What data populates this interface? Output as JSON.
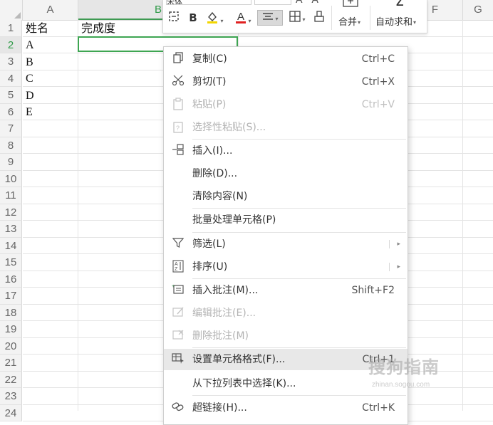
{
  "columns": [
    "A",
    "B",
    "F",
    "G"
  ],
  "rows": [
    "1",
    "2",
    "3",
    "4",
    "5",
    "6",
    "7",
    "8",
    "9",
    "10",
    "11",
    "12",
    "13",
    "14",
    "15",
    "16",
    "17",
    "18",
    "19",
    "20",
    "21",
    "22",
    "23",
    "24"
  ],
  "cells": {
    "A1": "姓名",
    "B1": "完成度",
    "A2": "A",
    "A3": "B",
    "A4": "C",
    "A5": "D",
    "A6": "E"
  },
  "mini_toolbar": {
    "font_name": "宋体",
    "merge_label": "合并",
    "autosum_label": "自动求和"
  },
  "context_menu": {
    "copy": {
      "label": "复制(C)",
      "shortcut": "Ctrl+C"
    },
    "cut": {
      "label": "剪切(T)",
      "shortcut": "Ctrl+X"
    },
    "paste": {
      "label": "粘贴(P)",
      "shortcut": "Ctrl+V"
    },
    "paste_special": {
      "label": "选择性粘贴(S)..."
    },
    "insert": {
      "label": "插入(I)..."
    },
    "delete": {
      "label": "删除(D)..."
    },
    "clear": {
      "label": "清除内容(N)"
    },
    "batch": {
      "label": "批量处理单元格(P)"
    },
    "filter": {
      "label": "筛选(L)"
    },
    "sort": {
      "label": "排序(U)"
    },
    "insert_comment": {
      "label": "插入批注(M)...",
      "shortcut": "Shift+F2"
    },
    "edit_comment": {
      "label": "编辑批注(E)..."
    },
    "delete_comment": {
      "label": "删除批注(M)"
    },
    "format_cells": {
      "label": "设置单元格格式(F)...",
      "shortcut": "Ctrl+1"
    },
    "pick_from_list": {
      "label": "从下拉列表中选择(K)..."
    },
    "hyperlink": {
      "label": "超链接(H)...",
      "shortcut": "Ctrl+K"
    }
  },
  "watermark": {
    "text": "搜狗指南",
    "sub": "zhinan.sogou.com"
  },
  "colors": {
    "selection": "#3ea552",
    "header_bg": "#f3f3f3",
    "menu_hover": "#e8e8e8"
  }
}
